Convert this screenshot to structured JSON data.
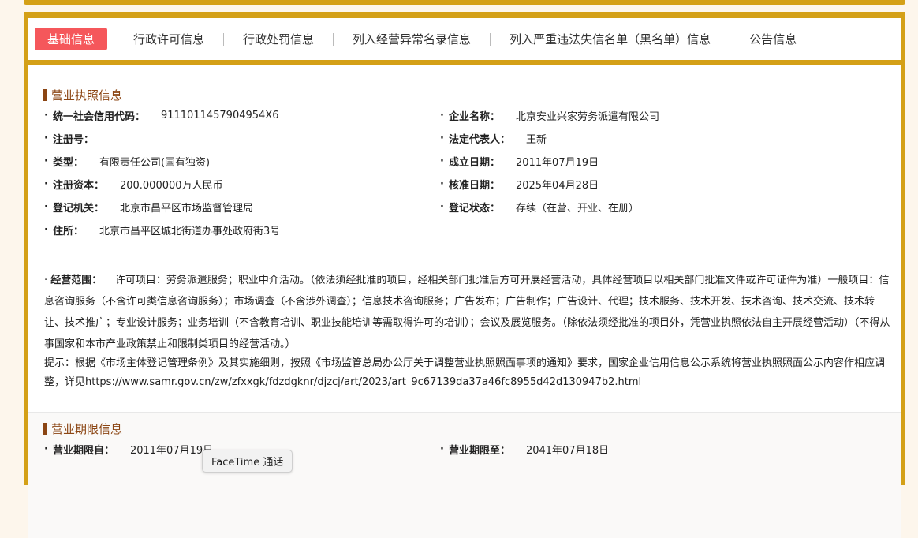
{
  "tabs": [
    {
      "label": "基础信息",
      "active": true
    },
    {
      "label": "行政许可信息",
      "active": false
    },
    {
      "label": "行政处罚信息",
      "active": false
    },
    {
      "label": "列入经营异常名录信息",
      "active": false
    },
    {
      "label": "列入严重违法失信名单（黑名单）信息",
      "active": false
    },
    {
      "label": "公告信息",
      "active": false
    }
  ],
  "license": {
    "title": "营业执照信息",
    "credit_code_label": "统一社会信用代码：",
    "credit_code": "9111011457904954X6",
    "company_name_label": "企业名称：",
    "company_name": "北京安业兴家劳务派遣有限公司",
    "reg_no_label": "注册号：",
    "reg_no": "",
    "legal_rep_label": "法定代表人：",
    "legal_rep": "王新",
    "type_label": "类型：",
    "type": "有限责任公司(国有独资)",
    "established_label": "成立日期：",
    "established": "2011年07月19日",
    "capital_label": "注册资本：",
    "capital": "200.000000万人民币",
    "approved_label": "核准日期：",
    "approved": "2025年04月28日",
    "authority_label": "登记机关：",
    "authority": "北京市昌平区市场监督管理局",
    "status_label": "登记状态：",
    "status": "存续（在营、开业、在册）",
    "address_label": "住所：",
    "address": "北京市昌平区城北街道办事处政府街3号",
    "scope_label": "经营范围：",
    "scope": "许可项目：劳务派遣服务；职业中介活动。（依法须经批准的项目，经相关部门批准后方可开展经营活动，具体经营项目以相关部门批准文件或许可证件为准）一般项目：信息咨询服务（不含许可类信息咨询服务）；市场调查（不含涉外调查）；信息技术咨询服务；广告发布；广告制作；广告设计、代理；技术服务、技术开发、技术咨询、技术交流、技术转让、技术推广；专业设计服务；业务培训（不含教育培训、职业技能培训等需取得许可的培训）；会议及展览服务。（除依法须经批准的项目外，凭营业执照依法自主开展经营活动）（不得从事国家和本市产业政策禁止和限制类项目的经营活动。）",
    "tip": "提示：根据《市场主体登记管理条例》及其实施细则，按照《市场监管总局办公厅关于调整营业执照照面事项的通知》要求，国家企业信用信息公示系统将营业执照照面公示内容作相应调整，详见https://www.samr.gov.cn/zw/zfxxgk/fdzdgknr/djzcj/art/2023/art_9c67139da37a46fc8955d42d130947b2.html"
  },
  "term": {
    "title": "营业期限信息",
    "from_label": "营业期限自：",
    "from": "2011年07月19日",
    "to_label": "营业期限至：",
    "to": "2041年07月18日"
  },
  "tooltip": "FaceTime 通话",
  "colors": {
    "accent": "#d4a017",
    "active_tab": "#f5575b",
    "section_title": "#8b4513"
  }
}
